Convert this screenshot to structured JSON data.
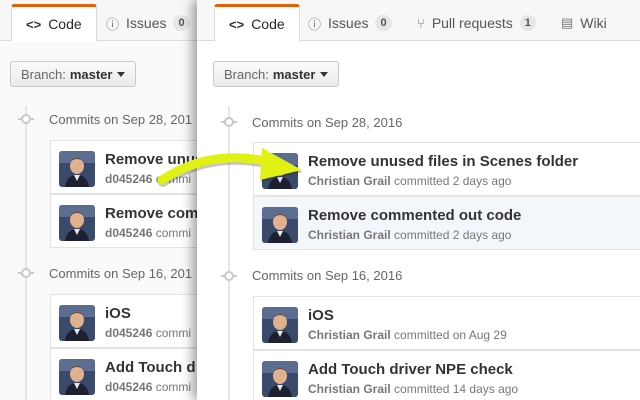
{
  "back": {
    "tabs": {
      "code": {
        "label": "Code",
        "icon": "<>"
      },
      "issues": {
        "label": "Issues",
        "count": "0"
      }
    },
    "branch": {
      "prefix": "Branch:",
      "name": "master"
    },
    "groups": [
      {
        "heading": "Commits on Sep 28, 201",
        "commits": [
          {
            "title": "Remove unus",
            "sha": "d045246",
            "meta": "commi"
          },
          {
            "title": "Remove comm",
            "sha": "d045246",
            "meta": "commi"
          }
        ]
      },
      {
        "heading": "Commits on Sep 16, 201",
        "commits": [
          {
            "title": "iOS",
            "sha": "d045246",
            "meta": "commi"
          },
          {
            "title": "Add Touch d",
            "sha": "d045246",
            "meta": "commi"
          }
        ]
      }
    ]
  },
  "front": {
    "tabs": {
      "code": {
        "label": "Code",
        "icon": "<>"
      },
      "issues": {
        "label": "Issues",
        "count": "0"
      },
      "pulls": {
        "label": "Pull requests",
        "count": "1"
      },
      "wiki": {
        "label": "Wiki"
      }
    },
    "branch": {
      "prefix": "Branch:",
      "name": "master"
    },
    "groups": [
      {
        "heading": "Commits on Sep 28, 2016",
        "commits": [
          {
            "title": "Remove unused files in Scenes folder",
            "author": "Christian Grail",
            "meta": "committed 2 days ago"
          },
          {
            "title": "Remove commented out code",
            "author": "Christian Grail",
            "meta": "committed 2 days ago"
          }
        ]
      },
      {
        "heading": "Commits on Sep 16, 2016",
        "commits": [
          {
            "title": "iOS",
            "author": "Christian Grail",
            "meta": "committed on Aug 29"
          },
          {
            "title": "Add Touch driver NPE check",
            "author": "Christian Grail",
            "meta": "committed 14 days ago"
          }
        ]
      }
    ]
  },
  "colors": {
    "accent_tab": "#e36209",
    "arrow": "#dff213"
  }
}
